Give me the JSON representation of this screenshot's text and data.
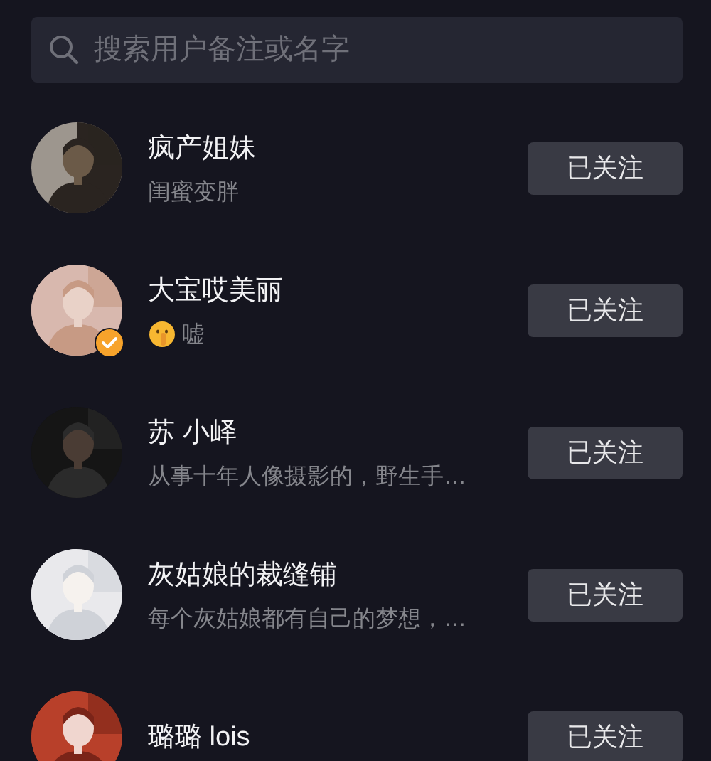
{
  "search": {
    "placeholder": "搜索用户备注或名字"
  },
  "users": [
    {
      "name": "疯产姐妹",
      "bio": "闺蜜变胖",
      "verified": false,
      "bio_emoji": false,
      "followed": true,
      "button": "已关注"
    },
    {
      "name": "大宝哎美丽",
      "bio": "嘘",
      "verified": true,
      "bio_emoji": true,
      "followed": true,
      "button": "已关注"
    },
    {
      "name": "苏 小峄",
      "bio": "从事十年人像摄影的，野生手…",
      "verified": false,
      "bio_emoji": false,
      "followed": true,
      "button": "已关注"
    },
    {
      "name": "灰姑娘的裁缝铺",
      "bio": "每个灰姑娘都有自己的梦想，…",
      "verified": false,
      "bio_emoji": false,
      "followed": true,
      "button": "已关注"
    },
    {
      "name": "璐璐 lois",
      "verified": false,
      "bio_emoji": false,
      "followed": true,
      "button": "已关注"
    }
  ]
}
